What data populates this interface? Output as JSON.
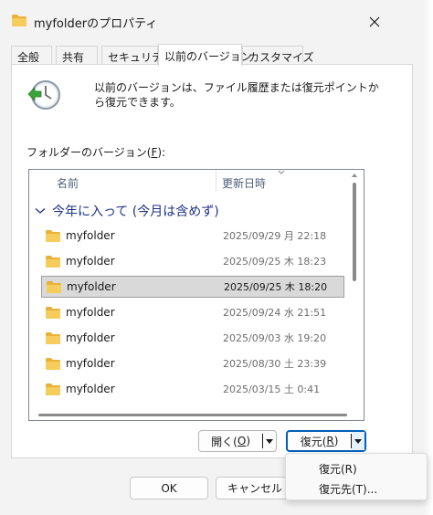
{
  "window": {
    "title": "myfolderのプロパティ"
  },
  "tabs": [
    {
      "label": "全般"
    },
    {
      "label": "共有"
    },
    {
      "label": "セキュリティ"
    },
    {
      "label": "以前のバージョン"
    },
    {
      "label": "カスタマイズ"
    }
  ],
  "active_tab": "以前のバージョン",
  "info": {
    "text": "以前のバージョンは、ファイル履歴または復元ポイントから復元できます。"
  },
  "versions_label": {
    "prefix": "フォルダーのバージョン(",
    "key": "F",
    "suffix": "):"
  },
  "list": {
    "columns": {
      "name": "名前",
      "modified": "更新日時"
    },
    "group": "今年に入って (今月は含めず)",
    "rows": [
      {
        "name": "myfolder",
        "date": "2025/09/29 月 22:18",
        "selected": false
      },
      {
        "name": "myfolder",
        "date": "2025/09/25 木 18:23",
        "selected": false
      },
      {
        "name": "myfolder",
        "date": "2025/09/25 木 18:20",
        "selected": true
      },
      {
        "name": "myfolder",
        "date": "2025/09/24 水 21:51",
        "selected": false
      },
      {
        "name": "myfolder",
        "date": "2025/09/03 水 19:20",
        "selected": false
      },
      {
        "name": "myfolder",
        "date": "2025/08/30 土 23:39",
        "selected": false
      },
      {
        "name": "myfolder",
        "date": "2025/03/15 土 0:41",
        "selected": false
      }
    ]
  },
  "buttons": {
    "open": {
      "prefix": "開く(",
      "key": "O",
      "suffix": ")"
    },
    "restore": {
      "prefix": "復元(",
      "key": "R",
      "suffix": ")"
    },
    "ok": "OK",
    "cancel": "キャンセル"
  },
  "restore_menu": {
    "items": [
      {
        "label": "復元(R)"
      },
      {
        "label": "復元先(T)..."
      }
    ]
  },
  "colors": {
    "accent": "#005fb8",
    "folder": "#f2c14e",
    "group_header": "#1e3287",
    "selection": "#d9d9d9"
  }
}
